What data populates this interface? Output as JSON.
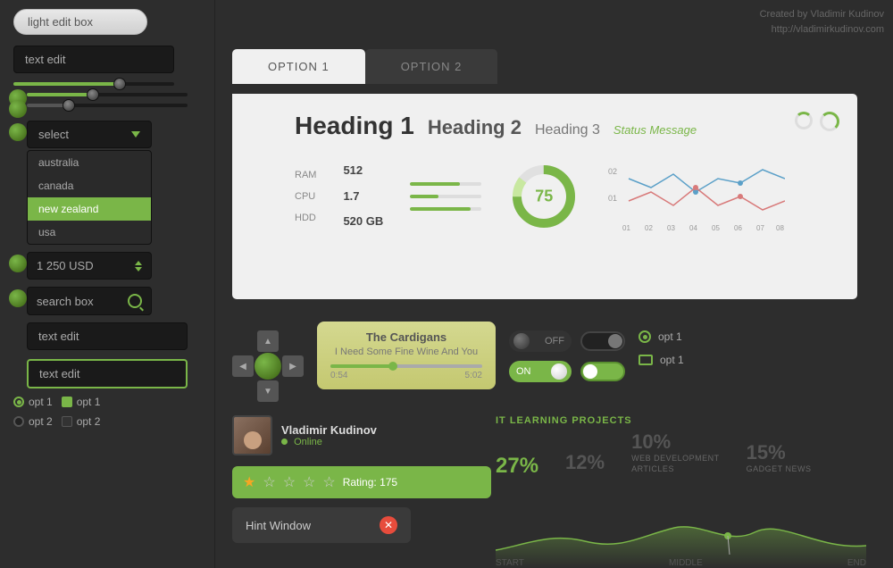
{
  "credit": {
    "line1": "Created by Vladimir Kudinov",
    "line2": "http://vladimirkudinov.com"
  },
  "left": {
    "light_edit_label": "light edit box",
    "text_edit_label": "text edit",
    "select_label": "select",
    "dropdown_items": [
      "australia",
      "canada",
      "new zealand",
      "usa"
    ],
    "selected_item": "new zealand",
    "number_value": "1 250 USD",
    "search_label": "search box",
    "text_edit2": "text edit",
    "text_edit3": "text edit",
    "opt1_radio": "opt 1",
    "opt2_radio": "opt 2",
    "opt1_check": "opt 1",
    "opt2_check": "opt 2"
  },
  "tabs": {
    "tab1": "OPTION 1",
    "tab2": "OPTION 2"
  },
  "dashboard": {
    "h1": "Heading 1",
    "h2": "Heading 2",
    "h3": "Heading 3",
    "status": "Status Message",
    "ram_label": "RAM",
    "cpu_label": "CPU",
    "hdd_label": "HDD",
    "ram_value": "512",
    "cpu_value": "1.7",
    "hdd_value": "520 GB",
    "donut_value": "75",
    "chart_labels": [
      "01",
      "02",
      "03",
      "04",
      "05",
      "06",
      "07",
      "08"
    ]
  },
  "music": {
    "band": "The Cardigans",
    "song": "I Need Some Fine Wine And You",
    "time_current": "0:54",
    "time_total": "5:02"
  },
  "toggles": {
    "off_label": "OFF",
    "on_label": "ON",
    "opt1": "opt 1",
    "opt1b": "opt 1"
  },
  "profile": {
    "name": "Vladimir Kudinov",
    "status": "Online",
    "rating_text": "Rating: 175",
    "hint": "Hint Window"
  },
  "it_stats": {
    "title": "IT LEARNING PROJECTS",
    "main_pct": "27",
    "pct_symbol": "%",
    "col2_pct": "12%",
    "col3_pct": "10%",
    "col3_label": "WEB DEVELOPMENT\nARTICLES",
    "col4_pct": "15%",
    "col4_label": "GADGET NEWS"
  },
  "wave": {
    "start": "START",
    "middle": "MIDDLE",
    "end": "END"
  }
}
